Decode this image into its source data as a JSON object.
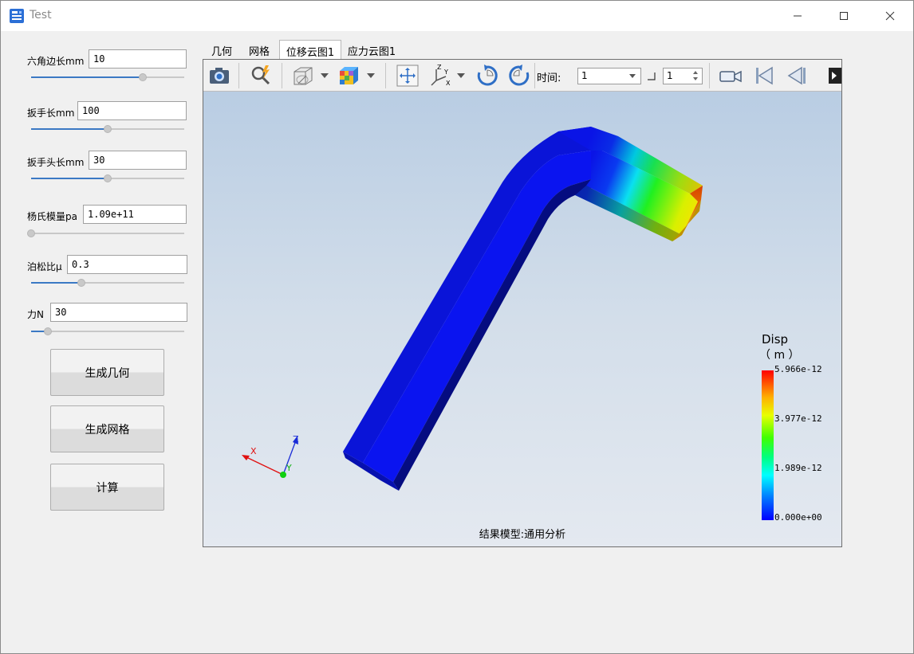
{
  "window": {
    "title": "Test"
  },
  "params": [
    {
      "label": "六角边长mm",
      "value": "10",
      "level": 0.73
    },
    {
      "label": "扳手长mm",
      "value": "100",
      "level": 0.5
    },
    {
      "label": "扳手头长mm",
      "value": "30",
      "level": 0.5
    },
    {
      "label": "杨氏模量pa",
      "value": "1.09e+11",
      "level": 0.0
    },
    {
      "label": "泊松比μ",
      "value": "0.3",
      "level": 0.33
    },
    {
      "label": "力N",
      "value": "30",
      "level": 0.11
    }
  ],
  "buttons": {
    "gen_geometry": "生成几何",
    "gen_mesh": "生成网格",
    "compute": "计算"
  },
  "tabs": [
    {
      "label": "几何",
      "active": false
    },
    {
      "label": "网格",
      "active": false
    },
    {
      "label": "位移云图1",
      "active": true
    },
    {
      "label": "应力云图1",
      "active": false
    }
  ],
  "toolbar": {
    "time_label": "时间:",
    "time_value": "1",
    "step_value": "1"
  },
  "legend": {
    "title": "Disp",
    "unit": "（ m ）",
    "ticks": [
      "5.966e-12",
      "3.977e-12",
      "1.989e-12",
      "0.000e+00"
    ]
  },
  "axes": {
    "x": "X",
    "y": "Y",
    "z": "Z"
  },
  "model_label": "结果模型:通用分析",
  "colors": {
    "accent": "#3b79c4",
    "mesh_blue": "#0a14e6"
  }
}
